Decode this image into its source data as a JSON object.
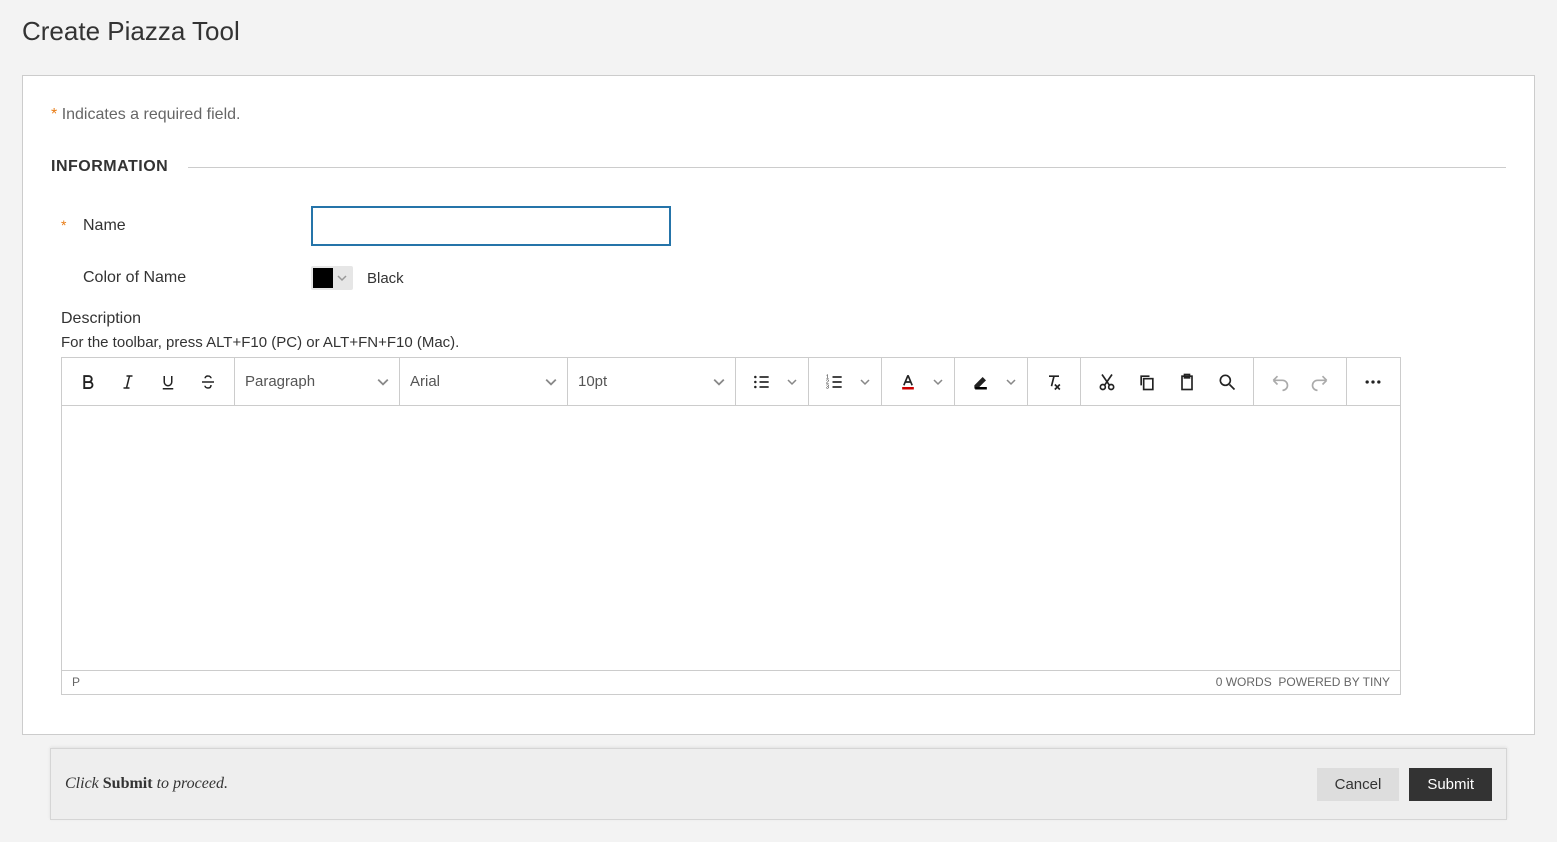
{
  "page_title": "Create Piazza Tool",
  "required_note": "Indicates a required field.",
  "section_title": "INFORMATION",
  "form": {
    "name_label": "Name",
    "name_value": "",
    "color_label": "Color of Name",
    "color_value": "Black",
    "description_label": "Description",
    "toolbar_hint": "For the toolbar, press ALT+F10 (PC) or ALT+FN+F10 (Mac)."
  },
  "editor": {
    "paragraph": "Paragraph",
    "font": "Arial",
    "size": "10pt",
    "status_path": "P",
    "status_words": "0 WORDS",
    "status_powered": "POWERED BY TINY"
  },
  "footer": {
    "hint_prefix": "Click ",
    "hint_bold": "Submit",
    "hint_suffix": " to proceed.",
    "cancel": "Cancel",
    "submit": "Submit"
  }
}
